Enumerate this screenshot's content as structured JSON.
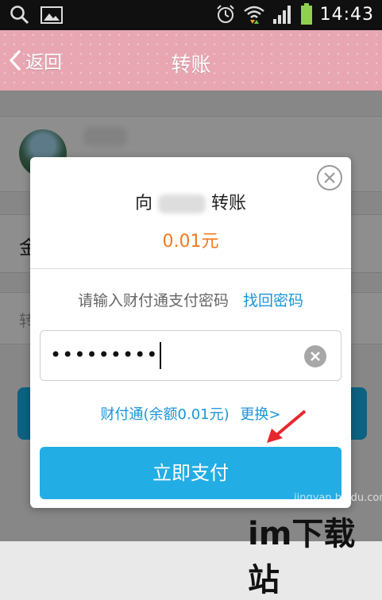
{
  "status_bar": {
    "time": "14:43"
  },
  "header": {
    "back_label": "返回",
    "title": "转账"
  },
  "background": {
    "amount_char": "金",
    "note_char": "转"
  },
  "dialog": {
    "recipient_prefix": "向",
    "recipient_suffix": "转账",
    "amount": "0.01元",
    "password_prompt": "请输入财付通支付密码",
    "forgot_password": "找回密码",
    "password_value": "•••••••••",
    "account_label": "财付通(余额0.01元)",
    "change_label": "更换>",
    "pay_button": "立即支付"
  },
  "watermark": {
    "text": "im下载站",
    "sub": "jingyan.baidu.com"
  },
  "colors": {
    "title_bar": "#e7a6b2",
    "amount": "#f07a22",
    "link": "#1a96d8",
    "pay_button": "#23ade5"
  }
}
